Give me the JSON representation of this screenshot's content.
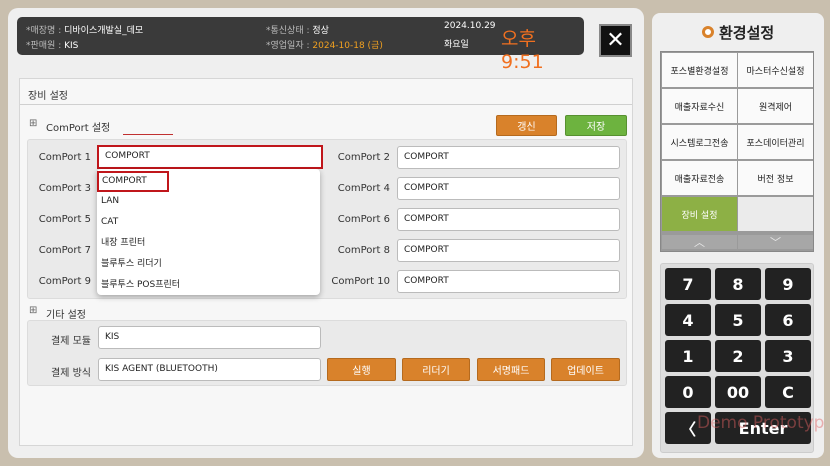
{
  "header": {
    "store_label": "*매장명 :",
    "store_value": "디바이스개발실_데모",
    "seller_label": "*판매원 :",
    "seller_value": "KIS",
    "comm_label": "*통신상태 :",
    "comm_value": "정상",
    "bizdate_label": "*영업일자 :",
    "bizdate_value": "2024-10-18 (금)",
    "date": "2024.10.29",
    "weekday": "화요일",
    "time": "오후 9:51",
    "close_glyph": "✕"
  },
  "device_settings": {
    "title": "장비 설정",
    "comport_section": {
      "toggle": "⊞",
      "title": "ComPort 설정",
      "refresh_label": "갱신",
      "save_label": "저장",
      "ports": [
        {
          "label": "ComPort 1",
          "value": "COMPORT"
        },
        {
          "label": "ComPort 2",
          "value": "COMPORT"
        },
        {
          "label": "ComPort 3",
          "value": ""
        },
        {
          "label": "ComPort 4",
          "value": "COMPORT"
        },
        {
          "label": "ComPort 5",
          "value": ""
        },
        {
          "label": "ComPort 6",
          "value": "COMPORT"
        },
        {
          "label": "ComPort 7",
          "value": ""
        },
        {
          "label": "ComPort 8",
          "value": "COMPORT"
        },
        {
          "label": "ComPort 9",
          "value": ""
        },
        {
          "label": "ComPort 10",
          "value": "COMPORT"
        }
      ],
      "dropdown_options": [
        "COMPORT",
        "LAN",
        "CAT",
        "내장 프린터",
        "블루투스 리더기",
        "블루투스 POS프린터"
      ]
    },
    "other_section": {
      "toggle": "⊞",
      "title": "기타 설정",
      "module_label": "결제 모듈",
      "module_value": "KIS",
      "method_label": "결제 방식",
      "method_value": "KIS AGENT (BLUETOOTH)",
      "buttons": [
        "실행",
        "리더기",
        "서명패드",
        "업데이트"
      ]
    }
  },
  "sidebar": {
    "title": "환경설정",
    "menu": [
      "포스별환경설정",
      "마스터수신설정",
      "매출자료수신",
      "원격제어",
      "시스템로그전송",
      "포스데이터관리",
      "매출자료전송",
      "버전 정보",
      "장비 설정",
      ""
    ],
    "up_arrow": "︿",
    "down_arrow": "﹀"
  },
  "keypad": {
    "keys": [
      "7",
      "8",
      "9",
      "4",
      "5",
      "6",
      "1",
      "2",
      "3",
      "0",
      "00",
      "C"
    ],
    "back": "〈",
    "enter": "Enter"
  },
  "watermark": "Demo Prototype",
  "colors": {
    "accent_orange": "#d9822b",
    "accent_green": "#6db33f",
    "selected_red": "#c0161b",
    "clock_orange": "#f07020",
    "menu_active": "#8db045"
  }
}
